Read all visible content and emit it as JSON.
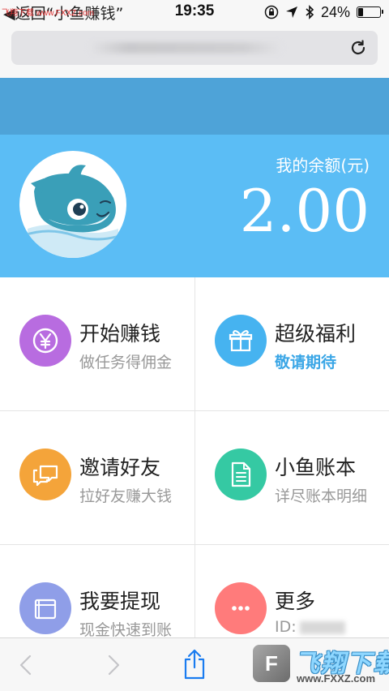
{
  "status_bar": {
    "back_text": "◀返回“小鱼赚钱”",
    "watermark_top": "飞翔下载 www.FXXZ.com",
    "time": "19:35",
    "battery_text": "24%",
    "battery_level": 0.24
  },
  "address_bar": {
    "url": "",
    "reload_icon": "reload-icon"
  },
  "hero": {
    "balance_label": "我的余额(元)",
    "balance_value": "2.00",
    "avatar_icon": "dolphin-avatar"
  },
  "menu": [
    {
      "title": "开始赚钱",
      "subtitle": "做任务得佣金",
      "icon": "yen-coin-icon",
      "color": "#b86ce0",
      "accent": false
    },
    {
      "title": "超级福利",
      "subtitle": "敬请期待",
      "icon": "gift-icon",
      "color": "#46b3f0",
      "accent": true
    },
    {
      "title": "邀请好友",
      "subtitle": "拉好友赚大钱",
      "icon": "chat-bubbles-icon",
      "color": "#f4a43a",
      "accent": false
    },
    {
      "title": "小鱼账本",
      "subtitle": "详尽账本明细",
      "icon": "document-icon",
      "color": "#35c9a3",
      "accent": false
    },
    {
      "title": "我要提现",
      "subtitle": "现金快速到账",
      "icon": "wallet-icon",
      "color": "#8f9ee8",
      "accent": false
    },
    {
      "title": "更多",
      "subtitle": "ID:",
      "icon": "more-dots-icon",
      "color": "#ff7b7b",
      "accent": false
    }
  ],
  "toolbar": {
    "back_icon": "back-chevron-icon",
    "forward_icon": "forward-chevron-icon",
    "share_icon": "share-icon"
  },
  "watermark": {
    "logo_letter": "F",
    "title": "飞翔下载",
    "url": "www.FXXZ.com"
  },
  "colors": {
    "band_dark": "#4ea3d8",
    "band_light": "#5bbdf5",
    "accent_text": "#3aa6e6"
  }
}
